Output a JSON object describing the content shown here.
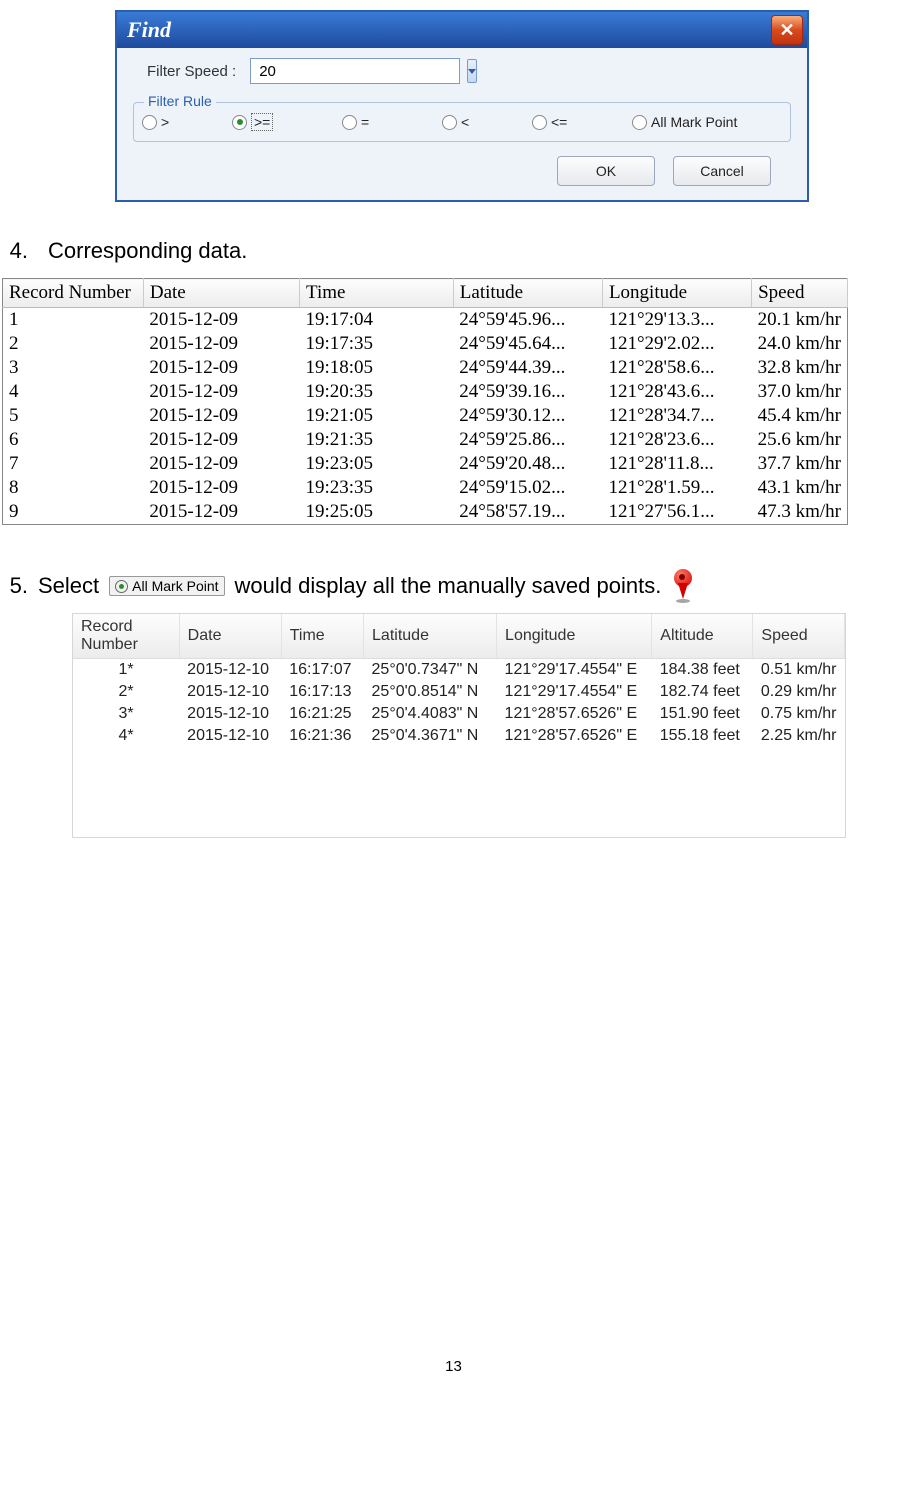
{
  "dialog": {
    "title": "Find",
    "filter_speed_label": "Filter Speed :",
    "filter_speed_value": "20",
    "filter_rule_legend": "Filter Rule",
    "radios": {
      "gt": ">",
      "gte": ">=",
      "eq": "=",
      "lt": "<",
      "lte": "<=",
      "all": "All Mark Point"
    },
    "ok": "OK",
    "cancel": "Cancel"
  },
  "step4": {
    "num": "4.",
    "text": "Corresponding data."
  },
  "table1": {
    "headers": {
      "rec": "Record Number",
      "date": "Date",
      "time": "Time",
      "lat": "Latitude",
      "lon": "Longitude",
      "speed": "Speed"
    },
    "rows": [
      {
        "rec": "1",
        "date": "2015-12-09",
        "time": "19:17:04",
        "lat": "24°59'45.96...",
        "lon": "121°29'13.3...",
        "speed": "20.1 km/hr"
      },
      {
        "rec": "2",
        "date": "2015-12-09",
        "time": "19:17:35",
        "lat": "24°59'45.64...",
        "lon": "121°29'2.02...",
        "speed": "24.0 km/hr"
      },
      {
        "rec": "3",
        "date": "2015-12-09",
        "time": "19:18:05",
        "lat": "24°59'44.39...",
        "lon": "121°28'58.6...",
        "speed": "32.8 km/hr"
      },
      {
        "rec": "4",
        "date": "2015-12-09",
        "time": "19:20:35",
        "lat": "24°59'39.16...",
        "lon": "121°28'43.6...",
        "speed": "37.0 km/hr"
      },
      {
        "rec": "5",
        "date": "2015-12-09",
        "time": "19:21:05",
        "lat": "24°59'30.12...",
        "lon": "121°28'34.7...",
        "speed": "45.4 km/hr"
      },
      {
        "rec": "6",
        "date": "2015-12-09",
        "time": "19:21:35",
        "lat": "24°59'25.86...",
        "lon": "121°28'23.6...",
        "speed": "25.6 km/hr"
      },
      {
        "rec": "7",
        "date": "2015-12-09",
        "time": "19:23:05",
        "lat": "24°59'20.48...",
        "lon": "121°28'11.8...",
        "speed": "37.7 km/hr"
      },
      {
        "rec": "8",
        "date": "2015-12-09",
        "time": "19:23:35",
        "lat": "24°59'15.02...",
        "lon": "121°28'1.59...",
        "speed": "43.1 km/hr"
      },
      {
        "rec": "9",
        "date": "2015-12-09",
        "time": "19:25:05",
        "lat": "24°58'57.19...",
        "lon": "121°27'56.1...",
        "speed": "47.3 km/hr"
      }
    ]
  },
  "step5": {
    "num": "5.",
    "text_a": "Select",
    "badge": "All Mark Point",
    "text_b": "would display all the manually saved points."
  },
  "table2": {
    "headers": {
      "rec": "Record Number",
      "date": "Date",
      "time": "Time",
      "lat": "Latitude",
      "lon": "Longitude",
      "alt": "Altitude",
      "speed": "Speed"
    },
    "rows": [
      {
        "rec": "1*",
        "date": "2015-12-10",
        "time": "16:17:07",
        "lat": "25°0'0.7347\" N",
        "lon": "121°29'17.4554\" E",
        "alt": "184.38 feet",
        "speed": "0.51 km/hr"
      },
      {
        "rec": "2*",
        "date": "2015-12-10",
        "time": "16:17:13",
        "lat": "25°0'0.8514\" N",
        "lon": "121°29'17.4554\" E",
        "alt": "182.74 feet",
        "speed": "0.29 km/hr"
      },
      {
        "rec": "3*",
        "date": "2015-12-10",
        "time": "16:21:25",
        "lat": "25°0'4.4083\" N",
        "lon": "121°28'57.6526\" E",
        "alt": "151.90 feet",
        "speed": "0.75 km/hr"
      },
      {
        "rec": "4*",
        "date": "2015-12-10",
        "time": "16:21:36",
        "lat": "25°0'4.3671\" N",
        "lon": "121°28'57.6526\" E",
        "alt": "155.18 feet",
        "speed": "2.25 km/hr"
      }
    ]
  },
  "page_number": "13"
}
